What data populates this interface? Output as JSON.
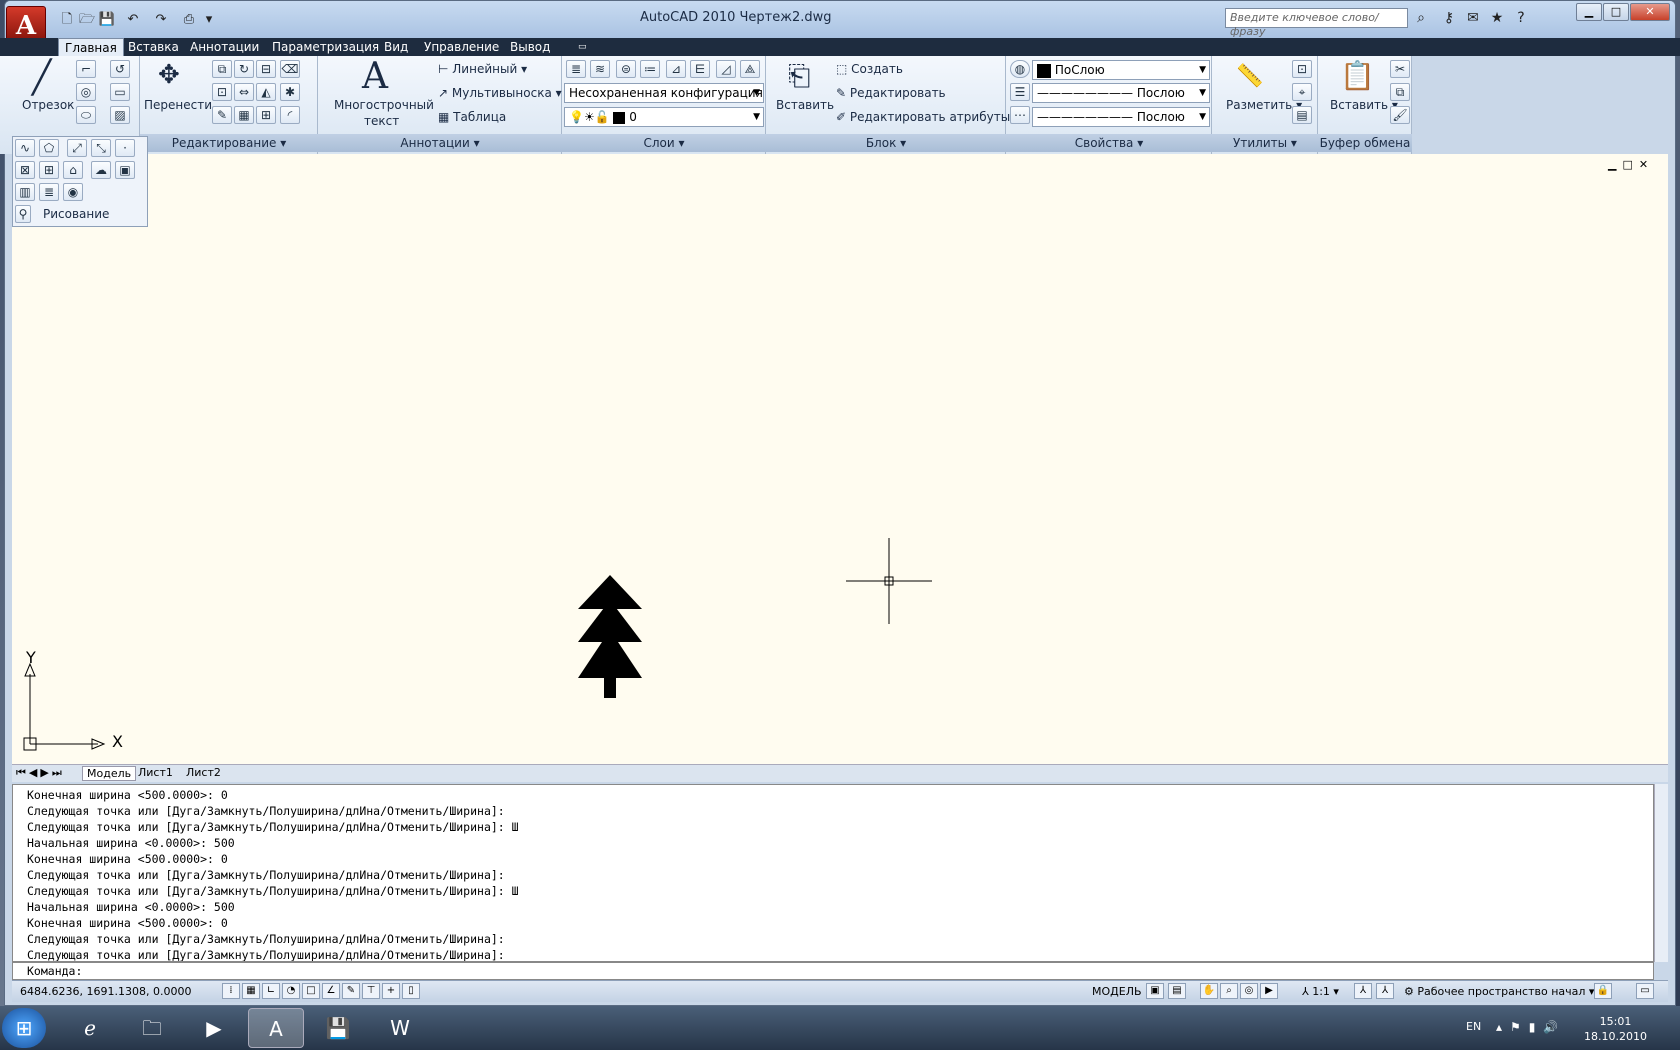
{
  "window": {
    "title": "AutoCAD 2010       Чертеж2.dwg",
    "app_letter": "A",
    "search_placeholder": "Введите ключевое слово/фразу"
  },
  "tabs": [
    "Главная",
    "Вставка",
    "Аннотации",
    "Параметризация",
    "Вид",
    "Управление",
    "Вывод"
  ],
  "ribbon": {
    "draw": {
      "line_label": "Отрезок",
      "title": "Рисование"
    },
    "modify": {
      "move_label": "Перенести",
      "title": "Редактирование"
    },
    "annot": {
      "mtext_label1": "Многострочный",
      "mtext_label2": "текст",
      "linear": "Линейный",
      "mleader": "Мультивыноска",
      "table": "Таблица",
      "title": "Аннотации"
    },
    "layers": {
      "config": "Несохраненная конфигурация сл",
      "layer": "0",
      "title": "Слои"
    },
    "block": {
      "insert": "Вставить",
      "create": "Создать",
      "edit": "Редактировать",
      "edit_attr": "Редактировать атрибуты",
      "title": "Блок"
    },
    "props": {
      "color": "ПоСлою",
      "lineweight": "Послою",
      "linetype": "Послою",
      "title": "Свойства"
    },
    "utils": {
      "measure": "Разметить",
      "title": "Утилиты"
    },
    "clipboard": {
      "paste": "Вставить",
      "title": "Буфер обмена"
    }
  },
  "layout_tabs": [
    "Модель",
    "Лист1",
    "Лист2"
  ],
  "ucs": {
    "x": "X",
    "y": "Y"
  },
  "command_history": [
    "Конечная ширина <500.0000>: 0",
    "Следующая точка или [Дуга/Замкнуть/Полуширина/длИна/Отменить/Ширина]:",
    "Следующая точка или [Дуга/Замкнуть/Полуширина/длИна/Отменить/Ширина]: Ш",
    "Начальная ширина <0.0000>: 500",
    "Конечная ширина <500.0000>: 0",
    "Следующая точка или [Дуга/Замкнуть/Полуширина/длИна/Отменить/Ширина]:",
    "Следующая точка или [Дуга/Замкнуть/Полуширина/длИна/Отменить/Ширина]: Ш",
    "Начальная ширина <0.0000>: 500",
    "Конечная ширина <500.0000>: 0",
    "Следующая точка или [Дуга/Замкнуть/Полуширина/длИна/Отменить/Ширина]:",
    "Следующая точка или [Дуга/Замкнуть/Полуширина/длИна/Отменить/Ширина]:"
  ],
  "command_prompt": "Команда:",
  "status": {
    "coords": "6484.6236, 1691.1308, 0.0000",
    "model": "МОДЕЛЬ",
    "scale": "1:1",
    "workspace": "Рабочее пространство начал"
  },
  "taskbar": {
    "lang": "EN",
    "time": "15:01",
    "date": "18.10.2010"
  }
}
